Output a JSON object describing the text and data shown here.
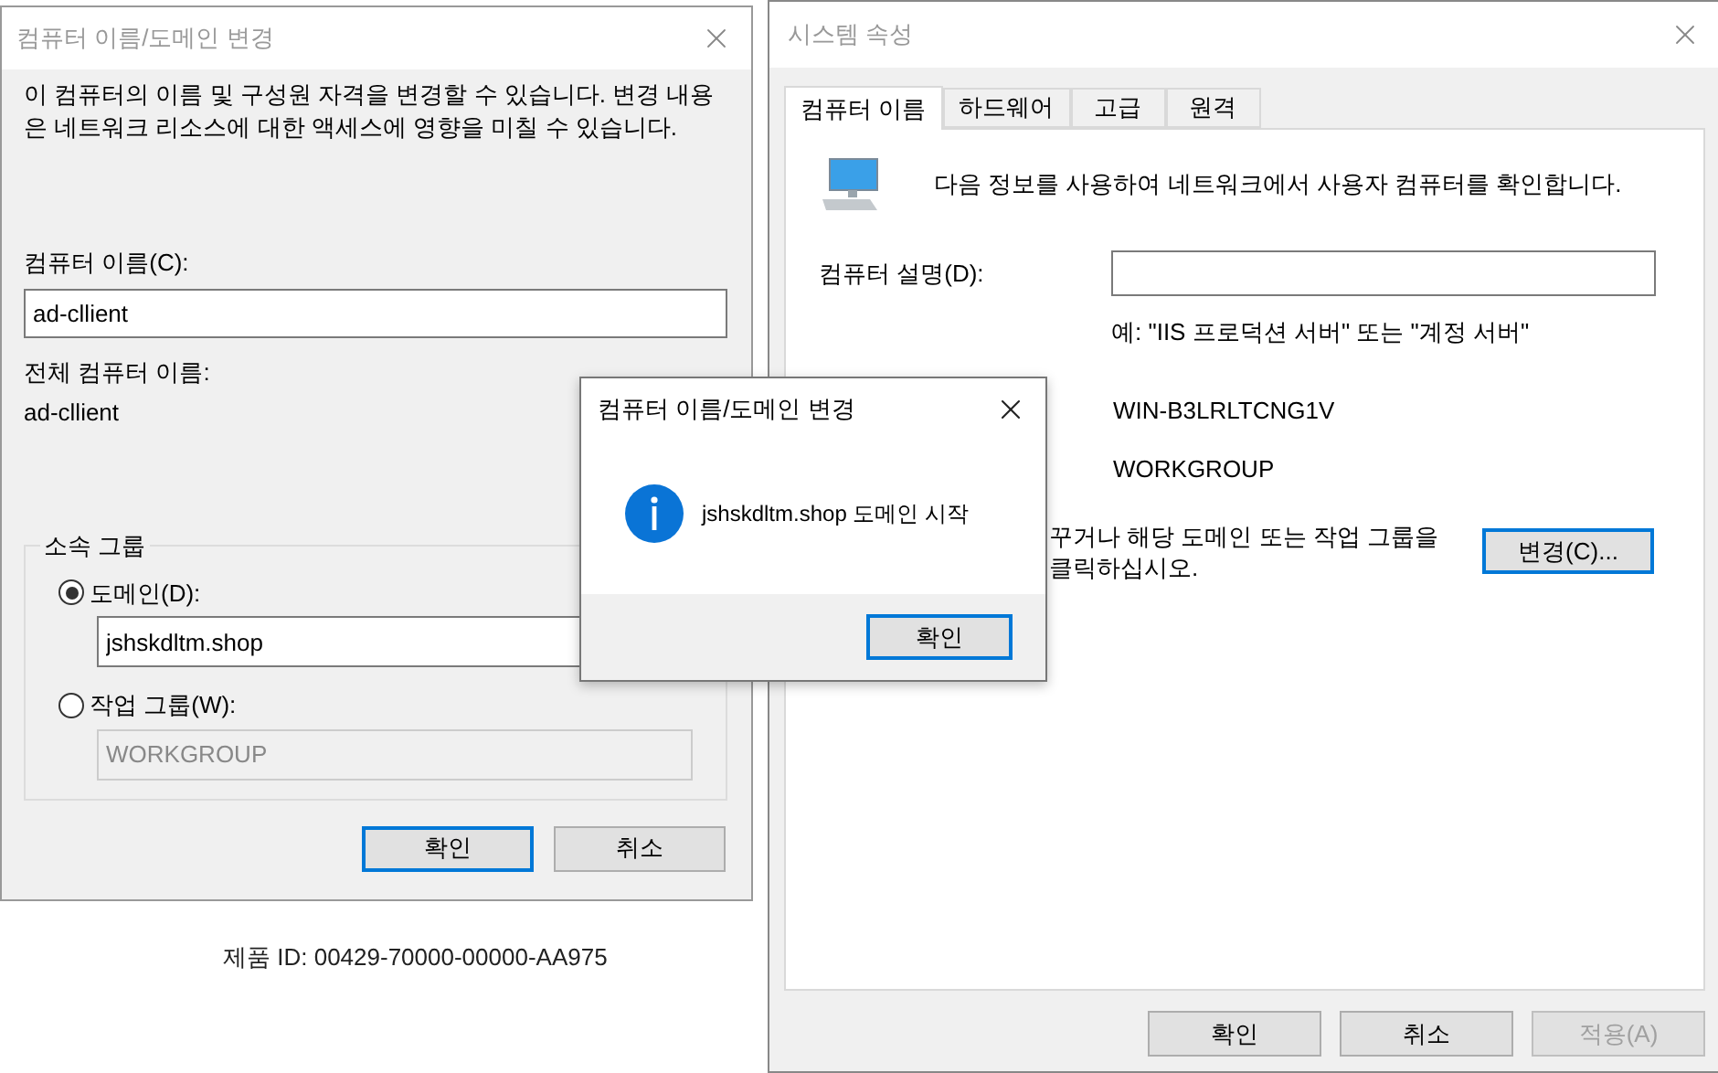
{
  "background": {
    "product_id": "제품 ID: 00429-70000-00000-AA975"
  },
  "change_dialog": {
    "title": "컴퓨터 이름/도메인 변경",
    "description": "이 컴퓨터의 이름 및 구성원 자격을 변경할 수 있습니다. 변경 내용은 네트워크 리소스에 대한 액세스에 영향을 미칠 수 있습니다.",
    "computer_name_label": "컴퓨터 이름(C):",
    "computer_name_value": "ad-cllient",
    "full_name_label": "전체 컴퓨터 이름:",
    "full_name_value": "ad-cllient",
    "member_of": {
      "legend": "소속 그룹",
      "options": [
        {
          "label": "도메인(D):",
          "value": "jshskdltm.shop",
          "selected": true
        },
        {
          "label": "작업 그룹(W):",
          "value": "WORKGROUP",
          "selected": false
        }
      ]
    },
    "buttons": [
      {
        "label": "확인",
        "focused": true
      },
      {
        "label": "취소",
        "focused": false
      }
    ]
  },
  "system_properties": {
    "title": "시스템 속성",
    "tabs": [
      {
        "label": "컴퓨터 이름",
        "selected": true
      },
      {
        "label": "하드웨어",
        "selected": false
      },
      {
        "label": "고급",
        "selected": false
      },
      {
        "label": "원격",
        "selected": false
      }
    ],
    "intro": "다음 정보를 사용하여 네트워크에서 사용자 컴퓨터를 확인합니다.",
    "description_label": "컴퓨터 설명(D):",
    "hint": "예: \"IIS 프로덕션 서버\" 또는 \"계정 서버\"",
    "full_computer_name": "WIN-B3LRLTCNG1V",
    "workgroup": "WORKGROUP",
    "rename_text": [
      "꾸거나 해당 도메인 또는 작업 그룹을",
      "클릭하십시오."
    ],
    "change_button": {
      "label": "변경(C)...",
      "focused": true
    },
    "buttons": [
      {
        "label": "확인",
        "disabled": false
      },
      {
        "label": "취소",
        "disabled": false
      },
      {
        "label": "적용(A)",
        "disabled": true
      }
    ]
  },
  "message_box": {
    "title": "컴퓨터 이름/도메인 변경",
    "message": "jshskdltm.shop 도메인 시작",
    "button": {
      "label": "확인",
      "focused": true
    }
  }
}
